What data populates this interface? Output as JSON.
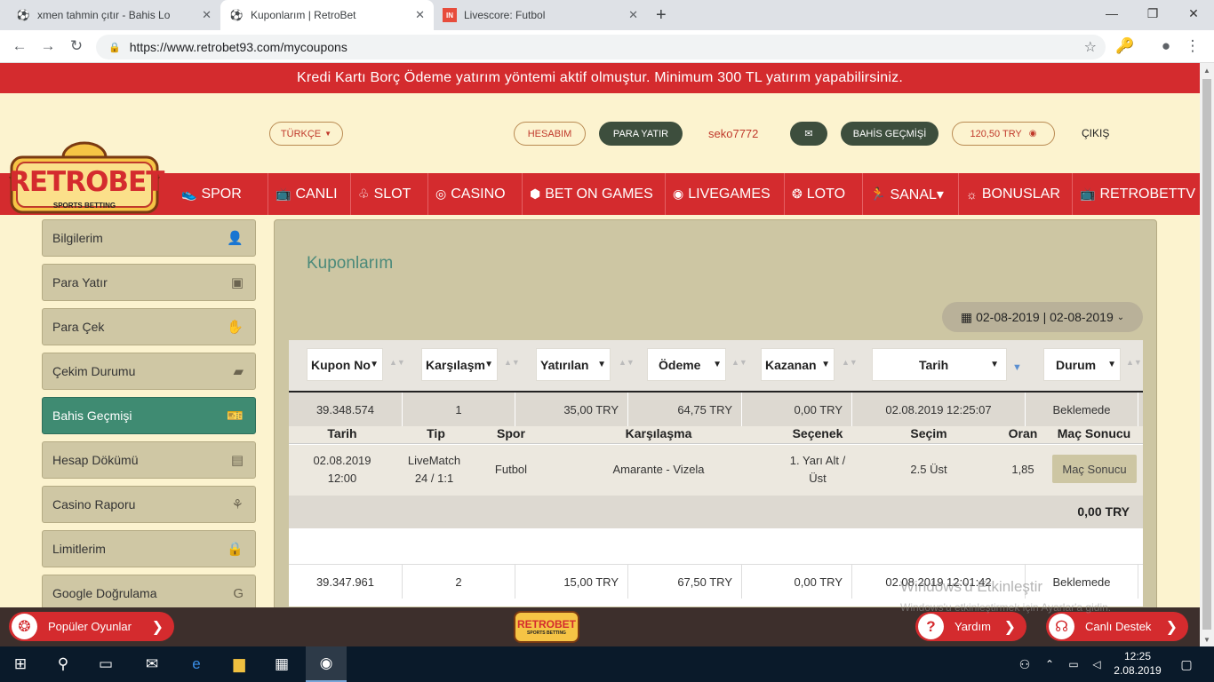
{
  "browser": {
    "tabs": [
      {
        "title": "xmen tahmin çıtır - Bahis Lokal -",
        "icon": "soccer-ball-icon"
      },
      {
        "title": "Kuponlarım | RetroBet",
        "icon": "soccer-ball-icon",
        "active": true
      },
      {
        "title": "Livescore: Futbol",
        "icon": "livescore-icon"
      }
    ],
    "url": "https://www.retrobet93.com/mycoupons"
  },
  "announcement": "Kredi Kartı Borç Ödeme yatırım yöntemi aktif olmuştur. Minimum 300 TL yatırım yapabilirsiniz.",
  "header": {
    "language": "TÜRKÇE",
    "account": "HESABIM",
    "deposit": "PARA YATIR",
    "username": "seko7772",
    "bet_history": "BAHİS GEÇMİŞİ",
    "balance": "120,50 TRY",
    "logout": "ÇIKIŞ"
  },
  "logo": {
    "text": "RETROBET",
    "sub": "SPORTS BETTING"
  },
  "nav": [
    {
      "label": "SPOR",
      "icon": "shoe-icon"
    },
    {
      "label": "CANLI",
      "icon": "tv-icon"
    },
    {
      "label": "SLOT",
      "icon": "slot-icon"
    },
    {
      "label": "CASINO",
      "icon": "chip-icon"
    },
    {
      "label": "BET ON GAMES",
      "icon": "dice-icon"
    },
    {
      "label": "LIVEGAMES",
      "icon": "target-icon"
    },
    {
      "label": "LOTO",
      "icon": "loto-icon"
    },
    {
      "label": "SANAL▾",
      "icon": "runner-icon"
    },
    {
      "label": "BONUSLAR",
      "icon": "bulb-icon"
    },
    {
      "label": "RETROBETTV",
      "icon": "tv-icon"
    }
  ],
  "sidebar": [
    {
      "label": "Bilgilerim",
      "icon": "user-icon"
    },
    {
      "label": "Para Yatır",
      "icon": "wallet-icon"
    },
    {
      "label": "Para Çek",
      "icon": "hand-money-icon"
    },
    {
      "label": "Çekim Durumu",
      "icon": "money-icon"
    },
    {
      "label": "Bahis Geçmişi",
      "icon": "ticket-icon",
      "active": true
    },
    {
      "label": "Hesap Dökümü",
      "icon": "statement-icon"
    },
    {
      "label": "Casino Raporu",
      "icon": "cherry-icon"
    },
    {
      "label": "Limitlerim",
      "icon": "lock-icon"
    },
    {
      "label": "Google Doğrulama",
      "icon": "google-icon"
    }
  ],
  "main": {
    "title": "Kuponlarım",
    "date_range": "02-08-2019 | 02-08-2019",
    "columns": [
      "Kupon No",
      "Karşılaşm",
      "Yatırılan",
      "Ödeme",
      "Kazanan",
      "Tarih",
      "Durum"
    ],
    "coupons": [
      {
        "no": "39.348.574",
        "matches": "1",
        "stake": "35,00 TRY",
        "payout": "64,75 TRY",
        "won": "0,00 TRY",
        "date": "02.08.2019 12:25:07",
        "status": "Beklemede"
      },
      {
        "no": "39.347.961",
        "matches": "2",
        "stake": "15,00 TRY",
        "payout": "67,50 TRY",
        "won": "0,00 TRY",
        "date": "02.08.2019 12:01:42",
        "status": "Beklemede"
      }
    ],
    "detail_columns": [
      "Tarih",
      "Tip",
      "Spor",
      "Karşılaşma",
      "Seçenek",
      "Seçim",
      "Oran",
      "Maç Sonucu"
    ],
    "detail": {
      "date1": "02.08.2019",
      "date2": "12:00",
      "tip1": "LiveMatch",
      "tip2": "24 / 1:1",
      "sport": "Futbol",
      "match": "Amarante - Vizela",
      "option1": "1. Yarı Alt /",
      "option2": "Üst",
      "selection": "2.5 Üst",
      "odds": "1,85",
      "result_btn": "Maç Sonucu"
    },
    "total": "0,00 TRY"
  },
  "bottombar": {
    "popular": "Popüler Oyunlar",
    "help": "Yardım",
    "live_support": "Canlı Destek"
  },
  "watermark": {
    "line1": "Windows'u Etkinleştir",
    "line2": "Windows'u etkinleştirmek için Ayarlar'a gidin."
  },
  "taskbar": {
    "time": "12:25",
    "date": "2.08.2019"
  },
  "colors": {
    "brand_red": "#d42b2e",
    "active_green": "#3f8b72",
    "panel": "#cdc6a3",
    "page_bg": "#fcf3cf"
  }
}
